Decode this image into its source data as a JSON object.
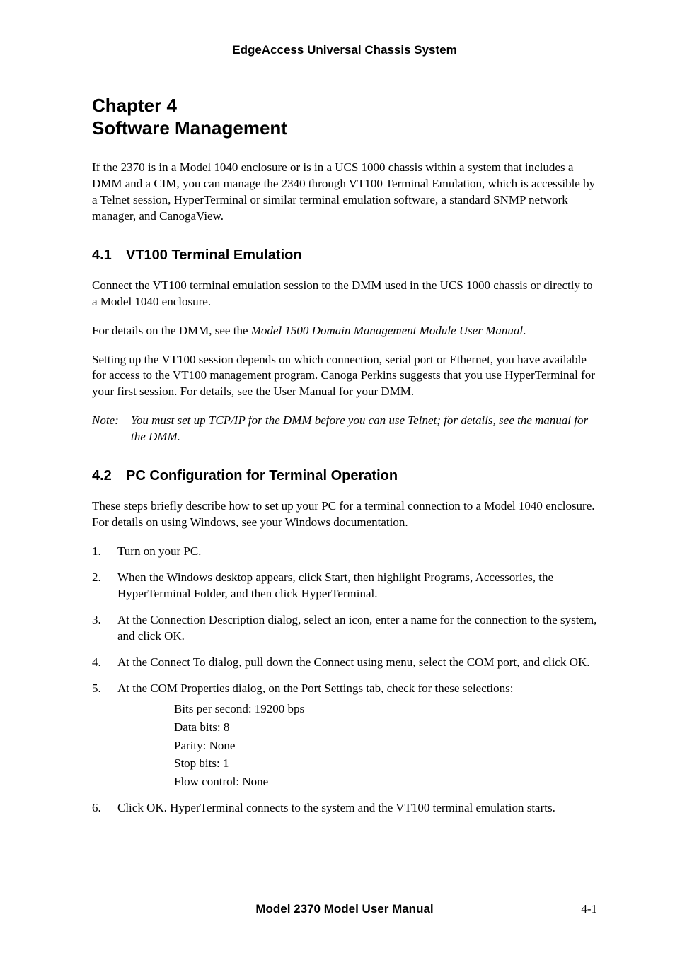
{
  "header": "EdgeAccess Universal Chassis System",
  "chapter": {
    "line1": "Chapter 4",
    "line2": "Software Management"
  },
  "intro": "If the 2370 is in a Model 1040 enclosure or is in a UCS 1000 chassis within a system that includes a DMM and a CIM, you can manage the 2340 through VT100 Terminal Emulation, which is accessible by a Telnet session, HyperTerminal or similar terminal emulation software, a standard SNMP network manager, and CanogaView.",
  "s41": {
    "num": "4.1",
    "title": "VT100 Terminal Emulation",
    "p1": "Connect the VT100 terminal emulation session to the DMM used in the UCS 1000 chassis or directly to a Model 1040 enclosure.",
    "p2a": "For details on the DMM, see the ",
    "p2b": "Model 1500 Domain Management Module User Manual",
    "p2c": ".",
    "p3": "Setting up the VT100 session depends on which connection, serial port or Ethernet, you have available for access to the VT100 management program.  Canoga Perkins suggests that you use HyperTerminal for your first session.  For details, see the User Manual for your DMM.",
    "noteLabel": "Note:",
    "noteBody": "You must set up TCP/IP for the DMM before you can use Telnet; for details, see the manual for the DMM."
  },
  "s42": {
    "num": "4.2",
    "title": "PC Configuration for Terminal Operation",
    "p1": "These steps briefly describe how to set up your PC for a terminal connection to a Model 1040 enclosure.  For details on using Windows, see your Windows documentation.",
    "steps": {
      "s1": "Turn on your PC.",
      "s2": "When the Windows desktop appears, click Start, then highlight Programs, Accessories, the HyperTerminal Folder, and then click HyperTerminal.",
      "s3": "At the Connection Description dialog, select an icon, enter a name for the connection to the system, and click OK.",
      "s4": "At the Connect To dialog, pull down the Connect using menu, select the COM port, and click OK.",
      "s5": "At the COM Properties dialog, on the Port Settings tab, check for these selections:",
      "s6": "Click OK.  HyperTerminal connects to the system and the VT100 terminal emulation starts."
    },
    "settings": {
      "l1": "Bits per second:  19200 bps",
      "l2": "Data bits:  8",
      "l3": "Parity:  None",
      "l4": "Stop bits:  1",
      "l5": "Flow control:  None"
    }
  },
  "footer": {
    "title": "Model 2370 Model User Manual",
    "page": "4-1"
  }
}
